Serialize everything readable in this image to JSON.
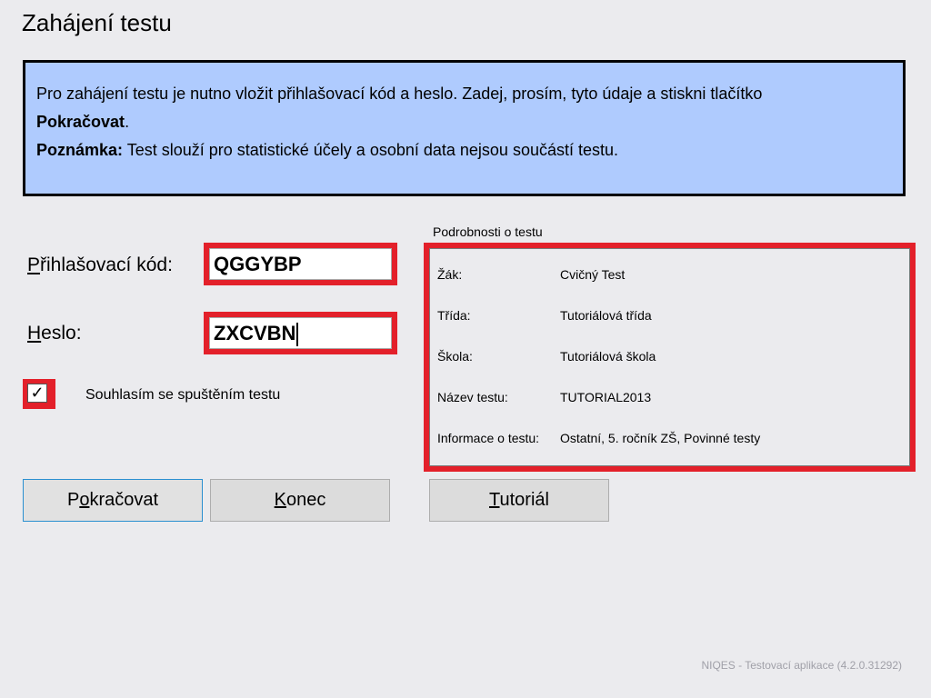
{
  "window": {
    "title": "Zahájení testu"
  },
  "info": {
    "line1_text": "Pro zahájení testu je nutno vložit přihlašovací kód a heslo. Zadej, prosím, tyto údaje a stiskni tlačítko",
    "line1_bold": "Pokračovat",
    "line1_end": ".",
    "note_label": "Poznámka:",
    "note_text": " Test slouží pro statistické účely a osobní data nejsou součástí testu."
  },
  "login": {
    "code_label_mnemonic": "P",
    "code_label_rest": "řihlašovací kód:",
    "code_value": "QGGYBP",
    "password_label_mnemonic": "H",
    "password_label_rest": "eslo:",
    "password_value": "ZXCVBN"
  },
  "consent": {
    "checked": true,
    "check_glyph": "✓",
    "label": "Souhlasím se spuštěním testu"
  },
  "details": {
    "caption": "Podrobnosti o testu",
    "rows": [
      {
        "key": "Žák:",
        "value": "Cvičný Test"
      },
      {
        "key": "Třída:",
        "value": "Tutoriálová třída"
      },
      {
        "key": "Škola:",
        "value": "Tutoriálová škola"
      },
      {
        "key": "Název testu:",
        "value": "TUTORIAL2013"
      },
      {
        "key": "Informace o testu:",
        "value": "Ostatní, 5. ročník ZŠ, Povinné testy"
      }
    ]
  },
  "buttons": {
    "continue_pre": "P",
    "continue_mnemonic": "o",
    "continue_post": "kračovat",
    "exit_mnemonic": "K",
    "exit_post": "onec",
    "tutorial_mnemonic": "T",
    "tutorial_post": "utoriál"
  },
  "footer": {
    "version_text": "NIQES - Testovací aplikace (4.2.0.31292)"
  },
  "colors": {
    "highlight": "#e3202a",
    "info_background": "#afcbfe",
    "window_background": "#ebebee"
  }
}
